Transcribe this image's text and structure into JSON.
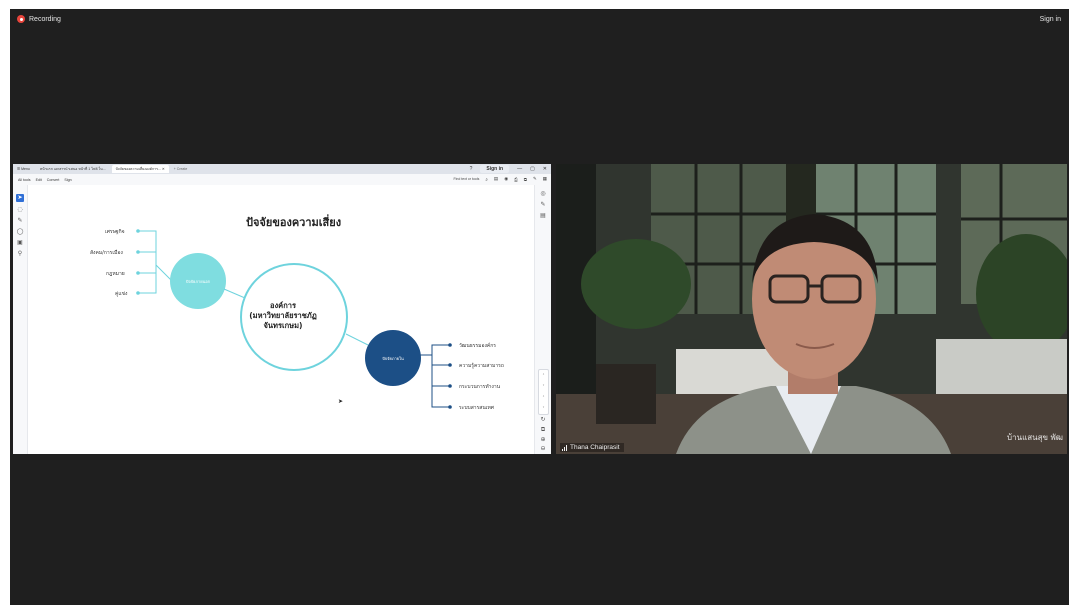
{
  "meeting": {
    "recording_label": "Recording",
    "sign_in_label": "Sign in",
    "participant_name": "Thana Chaiprasit",
    "video_background_text": "บ้านแสนสุข พัฒ"
  },
  "browser": {
    "tabs": [
      {
        "label": "Menu"
      },
      {
        "label": "หน้าแรก เอกสารนำเสนอ หน้าที่ 1 ไฟล์ ใน..."
      },
      {
        "label": "ปัจจัยของความเสี่ยงองค์การ..."
      },
      {
        "label": "+ Create"
      }
    ],
    "sign_in": "Sign in",
    "menu": [
      "All tools",
      "Edit",
      "Convert",
      "Sign"
    ],
    "find_text": "Find text or tools"
  },
  "slide": {
    "title": "ปัจจัยของความเสี่ยง",
    "center_node": [
      "องค์การ",
      "(มหาวิทยาลัยราชภัฏ",
      "จันทรเกษม)"
    ],
    "external_node": "ปัจจัยภายนอก",
    "internal_node": "ปัจจัยภายใน",
    "external_items": [
      "เศรษฐกิจ",
      "สังคม/การเมือง",
      "กฎหมาย",
      "คู่แข่ง"
    ],
    "internal_items": [
      "วัฒนธรรมองค์กร",
      "ความรู้ความสามารถ",
      "กระบวนการทำงาน",
      "ระบบสารสนเทศ"
    ],
    "colors": {
      "external": "#7fdde0",
      "internal": "#1c4f86",
      "center_ring": "#6ed3dd"
    }
  },
  "icons": {
    "record": "record-dot-icon",
    "cursor": "mouse-cursor-icon",
    "signal": "signal-bars-icon"
  }
}
